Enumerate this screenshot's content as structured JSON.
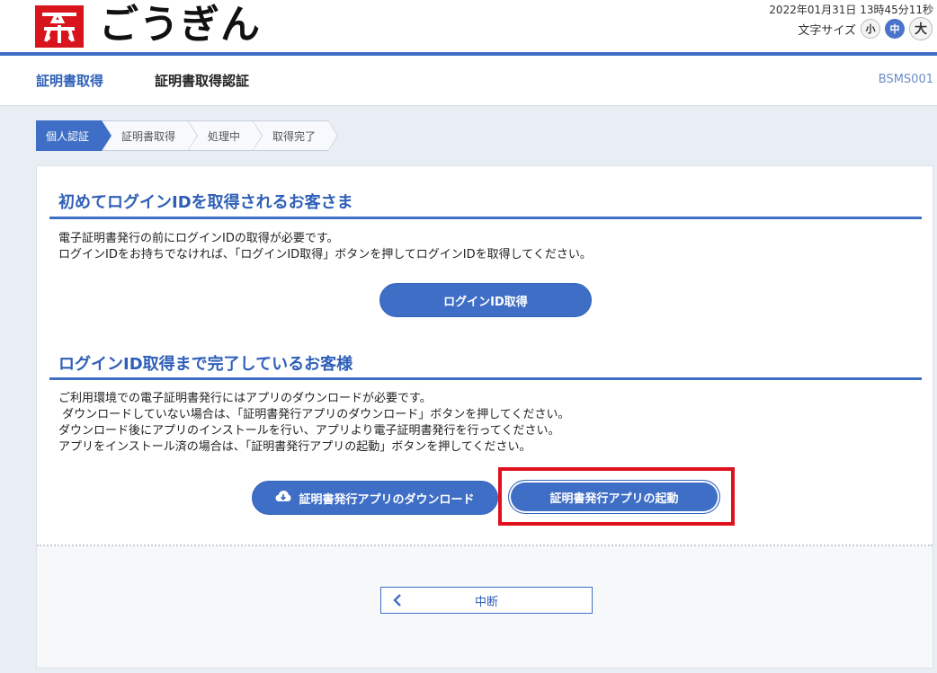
{
  "header": {
    "logo_text": "ごうぎん",
    "datetime": "2022年01月31日 13時45分11秒",
    "font_size_label": "文字サイズ",
    "font_sizes": [
      "小",
      "中",
      "大"
    ],
    "active_font_size": "中"
  },
  "titlebar": {
    "section": "証明書取得",
    "page": "証明書取得認証",
    "screen_code": "BSMS001"
  },
  "steps": [
    "個人認証",
    "証明書取得",
    "処理中",
    "取得完了"
  ],
  "active_step": "個人認証",
  "section1": {
    "title": "初めてログインIDを取得されるお客さま",
    "text": "電子証明書発行の前にログインIDの取得が必要です。\nログインIDをお持ちでなければ、「ログインID取得」ボタンを押してログインIDを取得してください。",
    "button": "ログインID取得"
  },
  "section2": {
    "title": "ログインID取得まで完了しているお客様",
    "text": "ご利用環境での電子証明書発行にはアプリのダウンロードが必要です。\n ダウンロードしていない場合は、「証明書発行アプリのダウンロード」ボタンを押してください。\nダウンロード後にアプリのインストールを行い、アプリより電子証明書発行を行ってください。\nアプリをインストール済の場合は、「証明書発行アプリの起動」ボタンを押してください。",
    "download_button": "証明書発行アプリのダウンロード",
    "launch_button": "証明書発行アプリの起動"
  },
  "footer": {
    "cancel_button": "中断"
  },
  "colors": {
    "brand_blue": "#3f6ec6",
    "logo_red": "#d8141d",
    "highlight_red": "#e0101c"
  }
}
